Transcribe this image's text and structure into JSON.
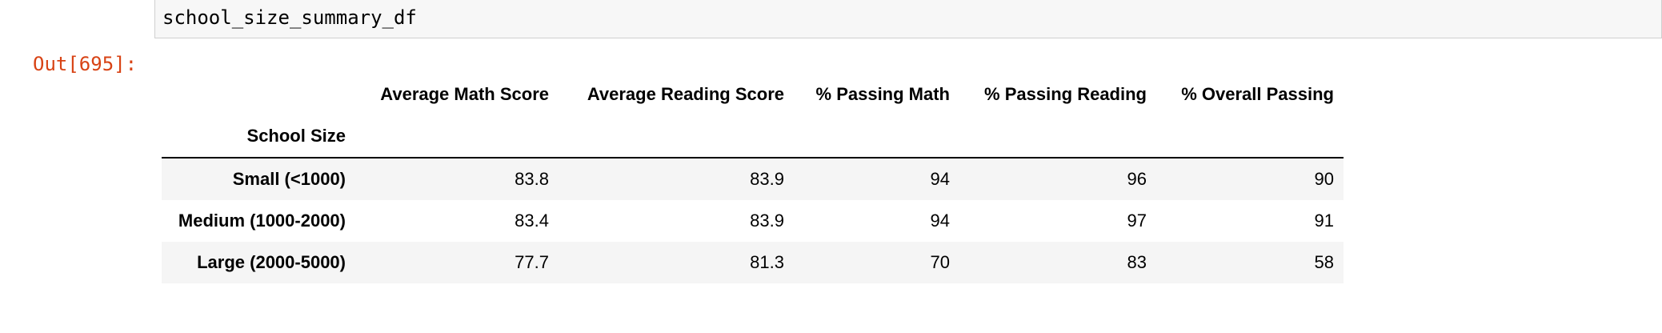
{
  "input_cell": {
    "code": "school_size_summary_df"
  },
  "output": {
    "prompt": "Out[695]:"
  },
  "table": {
    "columns": [
      "Average Math Score",
      "Average Reading Score",
      "% Passing Math",
      "% Passing Reading",
      "% Overall Passing"
    ],
    "index_name": "School Size",
    "rows": [
      {
        "index": "Small (<1000)",
        "values": [
          "83.8",
          "83.9",
          "94",
          "96",
          "90"
        ]
      },
      {
        "index": "Medium (1000-2000)",
        "values": [
          "83.4",
          "83.9",
          "94",
          "97",
          "91"
        ]
      },
      {
        "index": "Large (2000-5000)",
        "values": [
          "77.7",
          "81.3",
          "70",
          "83",
          "58"
        ]
      }
    ]
  }
}
